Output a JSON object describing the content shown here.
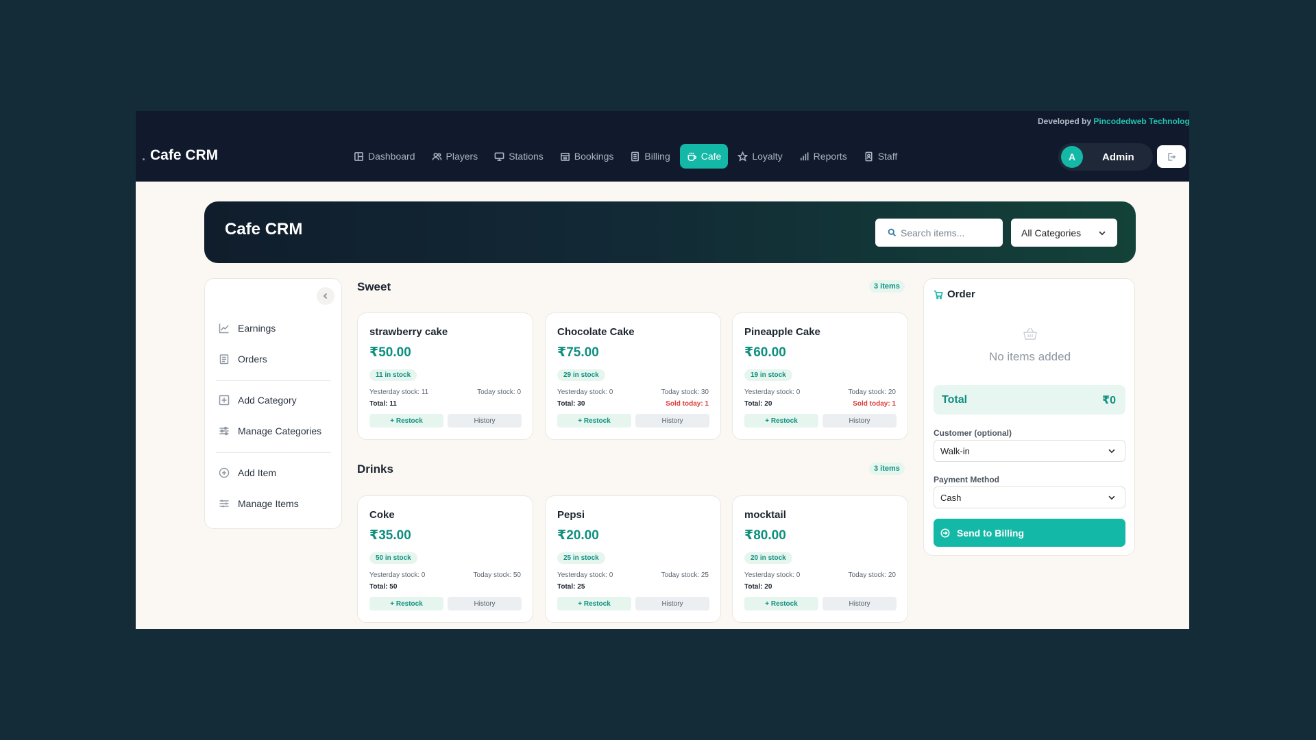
{
  "topbar": {
    "developer_prefix": "Developed by",
    "developer_company": "Pincodedweb Technologies",
    "brand": "Cafe CRM",
    "nav": [
      {
        "label": "Dashboard",
        "icon": "dashboard-icon"
      },
      {
        "label": "Players",
        "icon": "users-icon"
      },
      {
        "label": "Stations",
        "icon": "monitor-icon"
      },
      {
        "label": "Bookings",
        "icon": "calendar-icon"
      },
      {
        "label": "Billing",
        "icon": "receipt-icon"
      },
      {
        "label": "Cafe",
        "icon": "coffee-icon",
        "active": true
      },
      {
        "label": "Loyalty",
        "icon": "star-icon"
      },
      {
        "label": "Reports",
        "icon": "bar-chart-icon"
      },
      {
        "label": "Staff",
        "icon": "badge-icon"
      }
    ],
    "user": {
      "initial": "A",
      "name": "Admin"
    },
    "logout_icon": "logout-icon"
  },
  "header": {
    "title": "Cafe CRM",
    "search_placeholder": "Search items...",
    "category_filter": "All Categories"
  },
  "sidebar": {
    "items": [
      {
        "label": "Earnings",
        "icon": "trend-chart-icon"
      },
      {
        "label": "Orders",
        "icon": "clipboard-icon"
      },
      {
        "label": "Add Category",
        "icon": "plus-square-icon"
      },
      {
        "label": "Manage Categories",
        "icon": "sliders-icon"
      },
      {
        "label": "Add Item",
        "icon": "plus-circle-icon"
      },
      {
        "label": "Manage Items",
        "icon": "adjust-icon"
      }
    ]
  },
  "sections": [
    {
      "title": "Sweet",
      "count": "3 items",
      "items": [
        {
          "name": "strawberry cake",
          "price": "₹50.00",
          "stock": "11 in stock",
          "yesterday": "Yesterday stock: 11",
          "today": "Today stock: 0",
          "total": "Total: 11",
          "sold": "",
          "restock": "+ Restock",
          "history": "History"
        },
        {
          "name": "Chocolate Cake",
          "price": "₹75.00",
          "stock": "29 in stock",
          "yesterday": "Yesterday stock: 0",
          "today": "Today stock: 30",
          "total": "Total: 30",
          "sold": "Sold today: 1",
          "restock": "+ Restock",
          "history": "History"
        },
        {
          "name": "Pineapple Cake",
          "price": "₹60.00",
          "stock": "19 in stock",
          "yesterday": "Yesterday stock: 0",
          "today": "Today stock: 20",
          "total": "Total: 20",
          "sold": "Sold today: 1",
          "restock": "+ Restock",
          "history": "History"
        }
      ]
    },
    {
      "title": "Drinks",
      "count": "3 items",
      "items": [
        {
          "name": "Coke",
          "price": "₹35.00",
          "stock": "50 in stock",
          "yesterday": "Yesterday stock: 0",
          "today": "Today stock: 50",
          "total": "Total: 50",
          "sold": "",
          "restock": "+ Restock",
          "history": "History"
        },
        {
          "name": "Pepsi",
          "price": "₹20.00",
          "stock": "25 in stock",
          "yesterday": "Yesterday stock: 0",
          "today": "Today stock: 25",
          "total": "Total: 25",
          "sold": "",
          "restock": "+ Restock",
          "history": "History"
        },
        {
          "name": "mocktail",
          "price": "₹80.00",
          "stock": "20 in stock",
          "yesterday": "Yesterday stock: 0",
          "today": "Today stock: 20",
          "total": "Total: 20",
          "sold": "",
          "restock": "+ Restock",
          "history": "History"
        }
      ]
    }
  ],
  "order": {
    "title": "Order",
    "empty_text": "No items added",
    "total_label": "Total",
    "total_value": "₹0",
    "customer_label": "Customer (optional)",
    "customer_value": "Walk-in",
    "payment_label": "Payment Method",
    "payment_value": "Cash",
    "send_button": "Send to Billing"
  },
  "colors": {
    "background": "#142c37",
    "topbar": "#111a2c",
    "accent": "#14b8a6",
    "price": "#0e8f7f",
    "sold": "#dc3b3b"
  }
}
